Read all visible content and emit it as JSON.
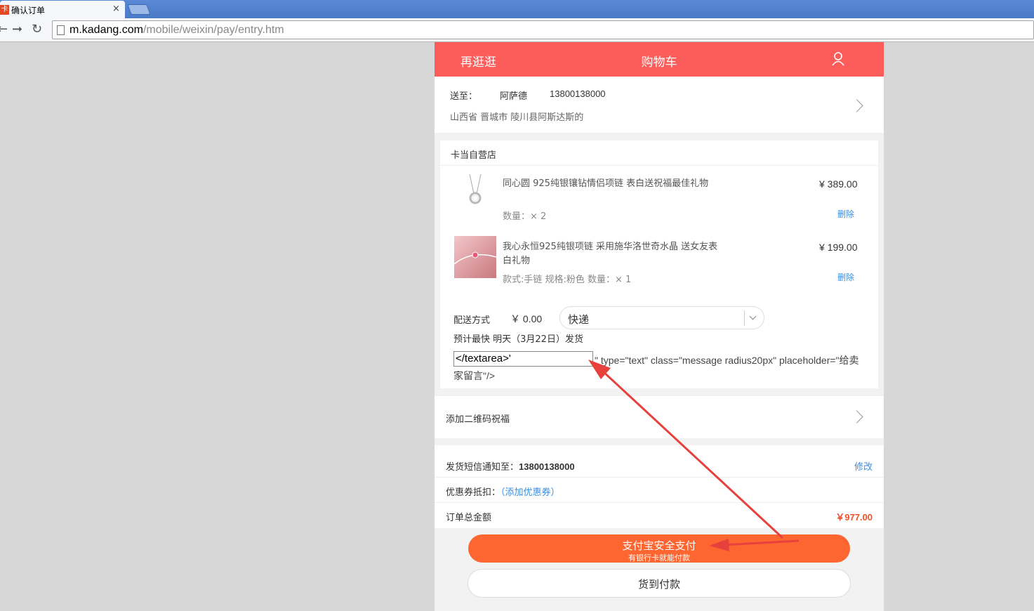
{
  "browser": {
    "tab_title": "确认订单",
    "tab_close": "×",
    "favicon_text": "卡",
    "url_host": "m.kadang.com",
    "url_path": "/mobile/weixin/pay/entry.htm"
  },
  "topbar": {
    "left_link": "再逛逛",
    "title": "购物车",
    "bg_color": "#fd5d5a"
  },
  "address": {
    "to_label": "送至：",
    "name": "阿萨德",
    "phone": "13800138000",
    "detail": "山西省 晋城市 陵川县阿斯达斯的"
  },
  "shop": {
    "title": "卡当自营店",
    "items": [
      {
        "name": "同心圆 925纯银镶钻情侣项链 表白送祝福最佳礼物",
        "meta": "数量：× 2",
        "price": "¥ 389.00",
        "delete_label": "删除"
      },
      {
        "name": "我心永恒925纯银项链 采用施华洛世奇水晶 送女友表白礼物",
        "meta": "款式:手链 规格:粉色 数量：× 1",
        "price": "¥ 199.00",
        "delete_label": "删除"
      }
    ],
    "shipping": {
      "label": "配送方式",
      "fee": "￥ 0.00",
      "method": "快递",
      "eta": "预计最快 明天（3月22日）发货"
    },
    "message": {
      "input_value": "</textarea>'",
      "leaked_html": "\" type=\"text\" class=\"message radius20px\" placeholder=\"给卖家留言\"/>"
    }
  },
  "qr_blessing": {
    "label": "添加二维码祝福"
  },
  "summary": {
    "sms_label": "发货短信通知至：",
    "sms_phone": "13800138000",
    "sms_edit": "修改",
    "coupon_label": "优惠券抵扣：",
    "coupon_link": "（添加优惠券）",
    "total_label": "订单总金额",
    "total_value": "￥977.00",
    "total_color": "#f0502a",
    "link_color": "#3a8de0"
  },
  "buttons": {
    "alipay_title": "支付宝安全支付",
    "alipay_subtitle": "有银行卡就能付款",
    "alipay_color": "#fd6631",
    "cod_label": "货到付款"
  },
  "annotation": {
    "color": "#e8413d"
  }
}
